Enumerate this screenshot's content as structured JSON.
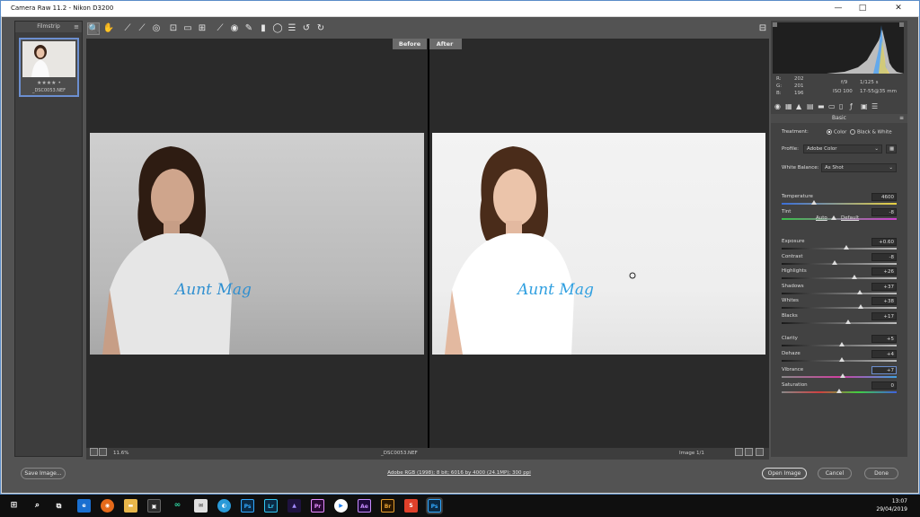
{
  "window": {
    "title": "Camera Raw 11.2  -  Nikon D3200",
    "minimize": "—",
    "maximize": "□",
    "close": "✕"
  },
  "filmstrip": {
    "header": "Filmstrip",
    "menu": "≡",
    "stars": "★★★★ •",
    "filename": "_DSC0053.NEF"
  },
  "toolbar": {
    "icons": [
      "zoom-icon",
      "hand-icon",
      "white-balance-icon",
      "color-sampler-icon",
      "target-adjust-icon",
      "crop-icon",
      "straighten-icon",
      "transform-icon",
      "spot-removal-icon",
      "red-eye-icon",
      "adjustment-brush-icon",
      "graduated-filter-icon",
      "radial-filter-icon",
      "preferences-icon",
      "rotate-left-icon",
      "rotate-right-icon"
    ],
    "glyphs": [
      "🔍",
      "✋",
      "⟋",
      "⟋",
      "◎",
      "⊡",
      "▭",
      "⊞",
      "⟋",
      "◉",
      "✎",
      "▮",
      "◯",
      "☰",
      "↺",
      "↻"
    ],
    "fullscreen": "⊟"
  },
  "preview": {
    "before_label": "Before",
    "after_label": "After"
  },
  "status": {
    "zoom": "11.6%",
    "filename": "_DSC0053.NEF",
    "image_counter": "Image 1/1"
  },
  "readout": {
    "r_label": "R:",
    "r": "202",
    "g_label": "G:",
    "g": "201",
    "b_label": "B:",
    "b": "196",
    "aperture": "f/9",
    "shutter": "1/125 s",
    "iso": "ISO 100",
    "lens": "17-55@35 mm"
  },
  "panel": {
    "title": "Basic",
    "treatment_label": "Treatment:",
    "treatment_color": "Color",
    "treatment_bw": "Black & White",
    "profile_label": "Profile:",
    "profile_value": "Adobe Color",
    "wb_label": "White Balance:",
    "wb_value": "As Shot",
    "auto": "Auto",
    "default": "Default",
    "sliders": [
      {
        "label": "Temperature",
        "value": "4600",
        "pos": 0.28
      },
      {
        "label": "Tint",
        "value": "-8",
        "pos": 0.45
      },
      {
        "label": "Exposure",
        "value": "+0.60",
        "pos": 0.56
      },
      {
        "label": "Contrast",
        "value": "-8",
        "pos": 0.46
      },
      {
        "label": "Highlights",
        "value": "+26",
        "pos": 0.63
      },
      {
        "label": "Shadows",
        "value": "+37",
        "pos": 0.68
      },
      {
        "label": "Whites",
        "value": "+38",
        "pos": 0.69
      },
      {
        "label": "Blacks",
        "value": "+17",
        "pos": 0.58
      },
      {
        "label": "Clarity",
        "value": "+5",
        "pos": 0.52
      },
      {
        "label": "Dehaze",
        "value": "+4",
        "pos": 0.52
      },
      {
        "label": "Vibrance",
        "value": "+7",
        "pos": 0.53
      },
      {
        "label": "Saturation",
        "value": "0",
        "pos": 0.5
      }
    ]
  },
  "bottom": {
    "save": "Save Image...",
    "workflow": "Adobe RGB (1998); 8 bit; 6016 by 4000 (24.1MP); 300 ppi",
    "open": "Open Image",
    "cancel": "Cancel",
    "done": "Done"
  },
  "taskbar": {
    "apps": [
      "Ps",
      "Lr",
      "Pr",
      "Ae",
      "Br",
      "Ps"
    ],
    "time": "13:07",
    "date": "29/04/2019"
  },
  "colors": {
    "accent": "#6c8fd0",
    "panel": "#535353",
    "preview_bg": "#2a2a2a"
  }
}
